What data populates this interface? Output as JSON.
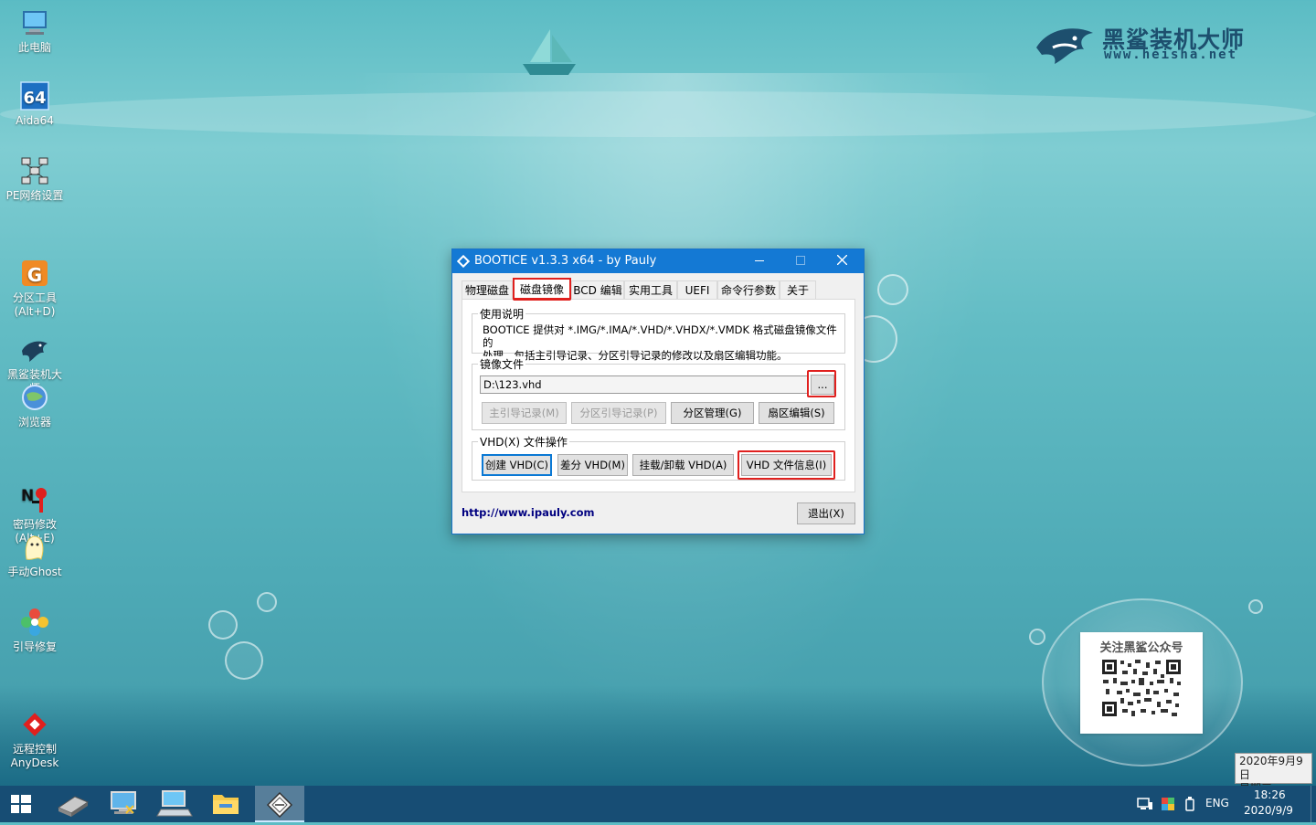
{
  "brand": {
    "name": "黑鲨装机大师",
    "url": "www.heisha.net"
  },
  "desktop_icons": [
    {
      "label": "此电脑",
      "icon": "computer-icon"
    },
    {
      "label": "Aida64",
      "icon": "aida64-icon"
    },
    {
      "label": "PE网络设置",
      "icon": "network-icon"
    },
    {
      "label": "分区工具\n(Alt+D)",
      "icon": "partition-tool-icon"
    },
    {
      "label": "黑鲨装机大\n师",
      "icon": "shark-icon"
    },
    {
      "label": "浏览器",
      "icon": "browser-icon"
    },
    {
      "label": "密码修改\n(Alt+E)",
      "icon": "password-icon"
    },
    {
      "label": "手动Ghost",
      "icon": "ghost-icon"
    },
    {
      "label": "引导修复",
      "icon": "boot-repair-icon"
    },
    {
      "label": "远程控制\nAnyDesk",
      "icon": "anydesk-icon"
    }
  ],
  "window": {
    "title": "BOOTICE v1.3.3 x64 - by Pauly",
    "tabs": [
      "物理磁盘",
      "磁盘镜像",
      "BCD 编辑",
      "实用工具",
      "UEFI",
      "命令行参数",
      "关于"
    ],
    "active_tab": "磁盘镜像",
    "usage": {
      "label": "使用说明",
      "line1": "BOOTICE 提供对 *.IMG/*.IMA/*.VHD/*.VHDX/*.VMDK 格式磁盘镜像文件的",
      "line2": "处理，包括主引导记录、分区引导记录的修改以及扇区编辑功能。"
    },
    "image_file": {
      "label": "镜像文件",
      "path": "D:\\123.vhd",
      "browse_label": "...",
      "buttons": [
        "主引导记录(M)",
        "分区引导记录(P)",
        "分区管理(G)",
        "扇区编辑(S)"
      ]
    },
    "vhd_ops": {
      "label": "VHD(X) 文件操作",
      "buttons": [
        "创建 VHD(C)",
        "差分 VHD(M)",
        "挂载/卸载 VHD(A)",
        "VHD 文件信息(I)"
      ]
    },
    "link": "http://www.ipauly.com",
    "exit_label": "退出(X)"
  },
  "qr": {
    "title": "关注黑鲨公众号"
  },
  "date_tip": {
    "date": "2020年9月9日",
    "weekday": "星期三"
  },
  "taskbar": {
    "tray_lang": "ENG",
    "time": "18:26",
    "date": "2020/9/9"
  },
  "colors": {
    "accent": "#1479d4",
    "highlight": "#e0201e",
    "taskbar": "#174d74"
  }
}
